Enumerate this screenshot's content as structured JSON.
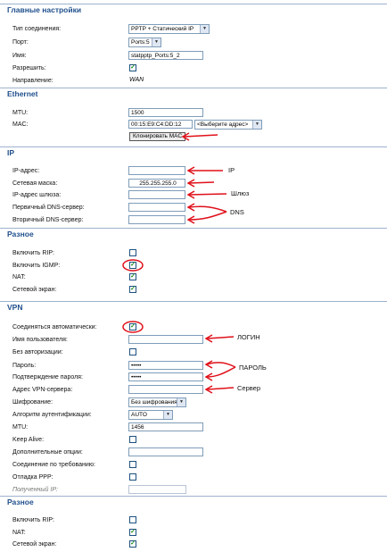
{
  "main": {
    "title": "Главные настройки",
    "conn_type_label": "Тип соединения:",
    "conn_type_value": "PPTP + Статический IP",
    "port_label": "Порт:",
    "port_value": "Ports:5",
    "name_label": "Имя:",
    "name_value": "statpptp_Ports:5_2",
    "allow_label": "Разрешить:",
    "direction_label": "Направление:",
    "direction_value": "WAN"
  },
  "ethernet": {
    "title": "Ethernet",
    "mtu_label": "MTU:",
    "mtu_value": "1500",
    "mac_label": "MAC:",
    "mac_value": "00:15:E9:C4:DD:12",
    "mac_select": "<Выберите адрес>",
    "clone_button": "Клонировать MAC"
  },
  "ip": {
    "title": "IP",
    "ip_label": "IP-адрес:",
    "mask_label": "Сетевая маска:",
    "mask_value": "255.255.255.0",
    "gw_label": "IP-адрес шлюза:",
    "dns1_label": "Первичный DNS-сервер:",
    "dns2_label": "Вторичный DNS-сервер:"
  },
  "misc1": {
    "title": "Разное",
    "rip_label": "Включить RIP:",
    "igmp_label": "Включить IGMP:",
    "nat_label": "NAT:",
    "fw_label": "Сетевой экран:"
  },
  "vpn": {
    "title": "VPN",
    "auto_label": "Соединяться автоматически:",
    "user_label": "Имя пользователя:",
    "noauth_label": "Без авторизации:",
    "pass_label": "Пароль:",
    "pass_value": "•••••",
    "pass_confirm_label": "Подтверждение пароля:",
    "pass_confirm_value": "•••••",
    "server_label": "Адрес VPN-сервера:",
    "enc_label": "Шифрование:",
    "enc_value": "Без шифрования",
    "auth_label": "Алгоритм аутентификации:",
    "auth_value": "AUTO",
    "mtu_label": "MTU:",
    "mtu_value": "1456",
    "keepalive_label": "Keep Alive:",
    "extra_label": "Дополнительные опции:",
    "ondemand_label": "Соединение по требованию:",
    "debug_label": "Отладка PPP:",
    "received_ip_label": "Полученный IP:"
  },
  "misc2": {
    "title": "Разное",
    "rip_label": "Включить RIP:",
    "nat_label": "NAT:",
    "fw_label": "Сетевой экран:"
  },
  "annotations": {
    "ip": "IP",
    "gateway": "Шлюз",
    "dns": "DNS",
    "login": "ЛОГИН",
    "password": "ПАРОЛЬ",
    "server": "Сервер"
  },
  "colors": {
    "accent": "#1f4f8c",
    "annotation": "#e0101a",
    "check": "#1a8a1a"
  }
}
